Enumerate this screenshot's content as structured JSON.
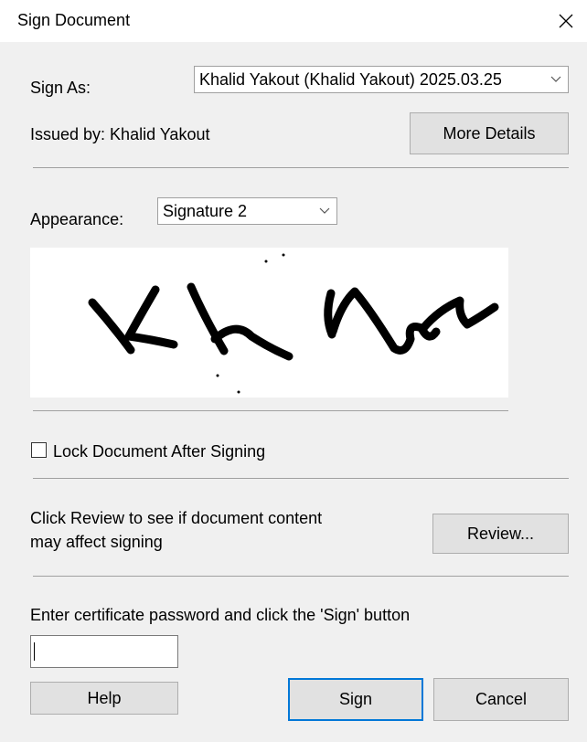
{
  "dialog": {
    "title": "Sign Document",
    "close_icon": "close-icon"
  },
  "sign_as": {
    "label": "Sign As:",
    "selected": "Khalid Yakout (Khalid Yakout) 2025.03.25"
  },
  "issued_by": "Issued by: Khalid Yakout",
  "more_details_label": "More Details",
  "appearance": {
    "label": "Appearance:",
    "selected": "Signature 2"
  },
  "signature_preview": "handwritten-signature",
  "lock_document": {
    "label": "Lock Document After Signing",
    "checked": false
  },
  "review": {
    "text_line1": "Click Review to see if document content",
    "text_line2": "may affect signing",
    "button_label": "Review..."
  },
  "password": {
    "instruction": "Enter certificate password and click the 'Sign' button",
    "value": ""
  },
  "buttons": {
    "help": "Help",
    "sign": "Sign",
    "cancel": "Cancel"
  },
  "colors": {
    "accent": "#0078d7",
    "dialog_bg": "#f0f0f0",
    "button_bg": "#e1e1e1"
  }
}
